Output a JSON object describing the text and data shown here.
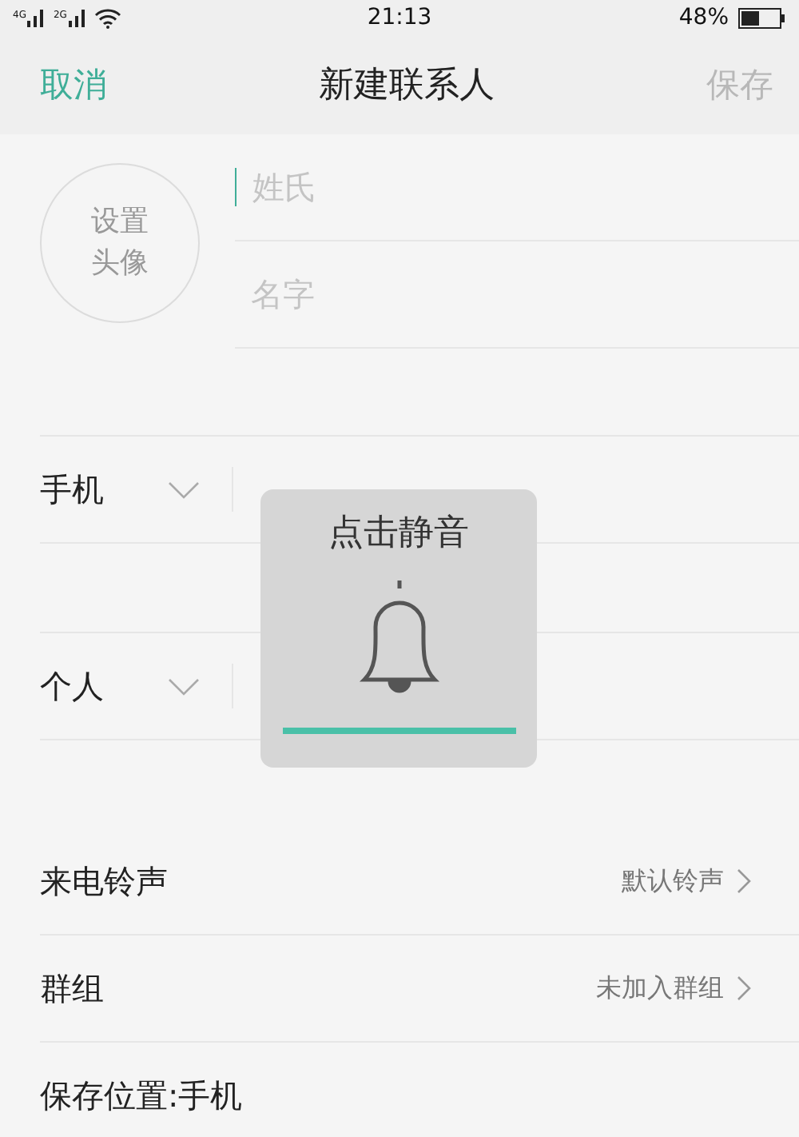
{
  "status_bar": {
    "networks": [
      "4G",
      "2G"
    ],
    "time": "21:13",
    "battery": "48%"
  },
  "header": {
    "cancel": "取消",
    "title": "新建联系人",
    "save": "保存",
    "save_disabled": true
  },
  "avatar": {
    "label": "设置头像"
  },
  "name_fields": [
    {
      "placeholder": "姓氏",
      "focused": true
    },
    {
      "placeholder": "名字",
      "focused": false
    }
  ],
  "contact_fields": [
    {
      "type_label": "手机"
    },
    {
      "type_label": "个人"
    }
  ],
  "settings": [
    {
      "label": "来电铃声",
      "value": "默认铃声"
    },
    {
      "label": "群组",
      "value": "未加入群组"
    }
  ],
  "storage": {
    "label": "保存位置:手机"
  },
  "toast": {
    "text": "点击静音",
    "level": 1
  }
}
